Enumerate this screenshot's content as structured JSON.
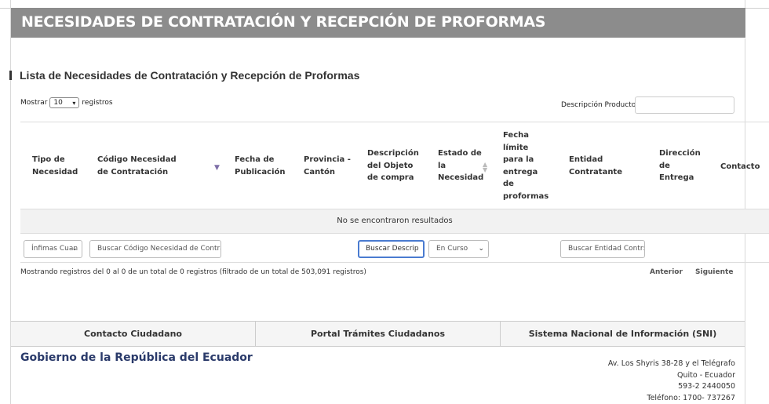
{
  "header": {
    "title": "NECESIDADES DE CONTRATACIÓN Y RECEPCIÓN DE PROFORMAS"
  },
  "section": {
    "title": "Lista de Necesidades de Contratación y Recepción de Proformas"
  },
  "length_control": {
    "prefix": "Mostrar",
    "value": "10",
    "suffix": "registros"
  },
  "search": {
    "label": "Descripción Producto:",
    "value": ""
  },
  "table": {
    "columns": {
      "tipo": "Tipo de Necesidad",
      "codigo": "Código Necesidad de Contratación",
      "fecha_pub": "Fecha de Publicación",
      "provincia": "Provincia - Cantón",
      "descripcion": "Descripción del Objeto de compra",
      "estado": "Estado de la Necesidad",
      "fecha_limite": "Fecha límite para la entrega de proformas",
      "entidad": "Entidad Contratante",
      "direccion": "Dirección de Entrega",
      "contacto": "Contacto"
    },
    "empty_message": "No se encontraron resultados",
    "filters": {
      "tipo_value": "Ínfimas Cuan",
      "codigo_placeholder": "Buscar Código Necesidad de Contra",
      "descripcion_placeholder": "Buscar Descrip",
      "estado_value": "En Curso",
      "entidad_placeholder": "Buscar Entidad Contr:"
    }
  },
  "info": "Mostrando registros del 0 al 0 de un total de 0 registros (filtrado de un total de 503,091 registros)",
  "pager": {
    "prev": "Anterior",
    "next": "Siguiente"
  },
  "footer": {
    "tabs": [
      "Contacto Ciudadano",
      "Portal Trámites Ciudadanos",
      "Sistema Nacional de Información (SNI)"
    ],
    "org": "Gobierno de la República del Ecuador",
    "address": [
      "Av. Los Shyris 38-28 y el Telégrafo",
      "Quito - Ecuador",
      "593-2 2440050",
      "Teléfono: 1700- 737267"
    ]
  }
}
